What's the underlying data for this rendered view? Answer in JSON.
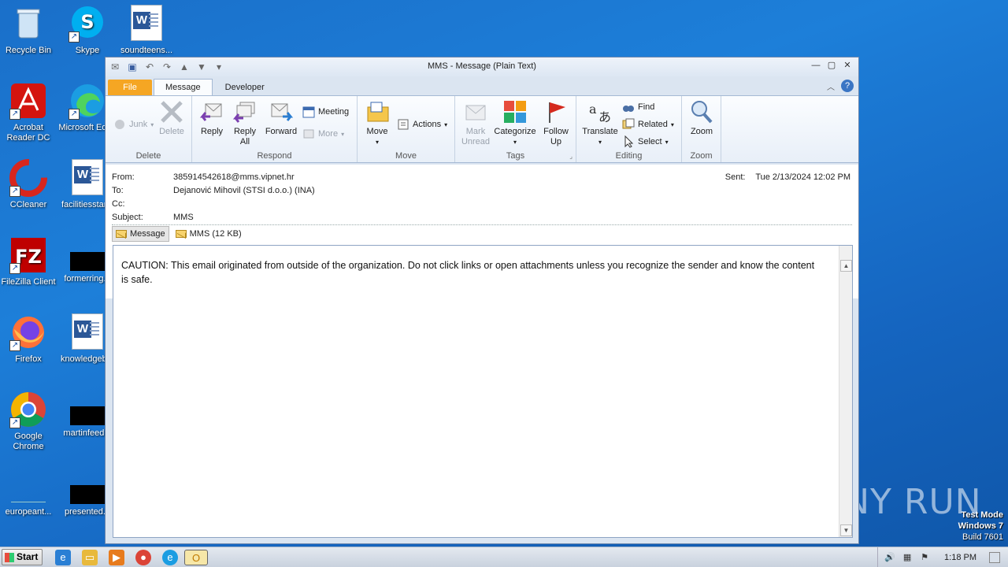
{
  "desktop": {
    "icons": [
      {
        "label": "Recycle Bin"
      },
      {
        "label": "Skype"
      },
      {
        "label": "soundteens..."
      },
      {
        "label": "Acrobat Reader DC"
      },
      {
        "label": "Microsoft Edge"
      },
      {
        "label": "facilitiesstar..."
      },
      {
        "label": "CCleaner"
      },
      {
        "label": "FileZilla Client"
      },
      {
        "label": "formerring..."
      },
      {
        "label": "Firefox"
      },
      {
        "label": "knowledgeb..."
      },
      {
        "label": "Google Chrome"
      },
      {
        "label": "martinfeed..."
      },
      {
        "label": "europeant..."
      },
      {
        "label": "presented..."
      }
    ],
    "watermark": "ANY RUN",
    "test_mode": {
      "line1": "Test Mode",
      "line2": "Windows 7",
      "line3": "Build 7601"
    }
  },
  "window": {
    "title": "MMS  -  Message (Plain Text)",
    "tabs": {
      "file": "File",
      "message": "Message",
      "developer": "Developer"
    },
    "ribbon": {
      "delete_group": {
        "label": "Delete",
        "junk": "Junk",
        "delete": "Delete"
      },
      "respond_group": {
        "label": "Respond",
        "reply": "Reply",
        "reply_all": "Reply All",
        "forward": "Forward",
        "meeting": "Meeting",
        "more": "More"
      },
      "move_group": {
        "label": "Move",
        "move": "Move",
        "actions": "Actions"
      },
      "tags_group": {
        "label": "Tags",
        "mark_unread": "Mark Unread",
        "categorize": "Categorize",
        "follow_up": "Follow Up"
      },
      "editing_group": {
        "label": "Editing",
        "translate": "Translate",
        "find": "Find",
        "related": "Related",
        "select": "Select"
      },
      "zoom_group": {
        "label": "Zoom",
        "zoom": "Zoom"
      }
    },
    "header": {
      "from_label": "From:",
      "from": "385914542618@mms.vipnet.hr",
      "to_label": "To:",
      "to": "Dejanović Mihovil (STSI d.o.o.) (INA)",
      "cc_label": "Cc:",
      "cc": "",
      "subject_label": "Subject:",
      "subject": "MMS",
      "sent_label": "Sent:",
      "sent": "Tue 2/13/2024 12:02 PM"
    },
    "attachments": [
      {
        "label": "Message"
      },
      {
        "label": "MMS (12 KB)"
      }
    ],
    "body": "CAUTION: This email originated from outside of the organization. Do not click links or open attachments unless you recognize the sender and know the content is safe."
  },
  "taskbar": {
    "start": "Start",
    "clock": "1:18 PM"
  }
}
